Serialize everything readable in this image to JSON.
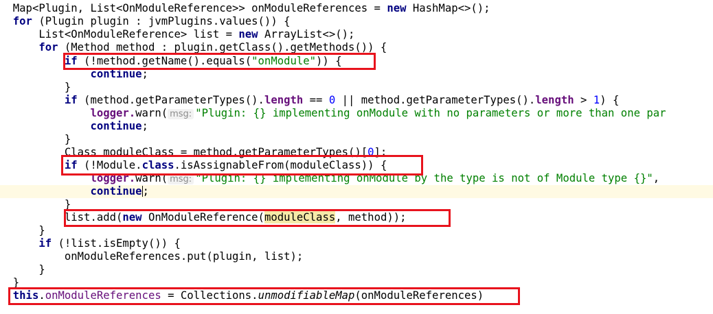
{
  "code": {
    "l1": {
      "a": "Map<Plugin, List<OnModuleReference>> onModuleReferences = ",
      "b": "new",
      "c": " HashMap<>();"
    },
    "l2": {
      "a": "for",
      "b": " (Plugin plugin : jvmPlugins.values()) {"
    },
    "l3": {
      "a": "List<OnModuleReference> list = ",
      "b": "new",
      "c": " ArrayList<>();"
    },
    "l4": {
      "a": "for",
      "b": " (Method method : plugin.getClass().getMethods()) {"
    },
    "l5": {
      "a": "if",
      "b": " (!method.getName().equals(",
      "c": "\"onModule\"",
      "d": ")) {"
    },
    "l6": {
      "a": "continue",
      "b": ";"
    },
    "l7": {
      "a": "}"
    },
    "l8": {
      "a": "if",
      "b": " (method.getParameterTypes().",
      "c": "length",
      "d": " == ",
      "e": "0",
      "f": " || method.getParameterTypes().",
      "g": "length",
      "h": " > ",
      "i": "1",
      "j": ") {"
    },
    "l9": {
      "a": "logger.",
      "b": "warn(",
      "hint": "msg:",
      "c": "\"Plugin: {} implementing onModule with no parameters or more than one par"
    },
    "l10": {
      "a": "continue",
      "b": ";"
    },
    "l11": {
      "a": "}"
    },
    "l12": {
      "a": "Class moduleClass = method.getParameterTypes()[",
      "b": "0",
      "c": "];"
    },
    "l13": {
      "a": "if",
      "b": " (!Module.",
      "c": "class",
      "d": ".isAssignableFrom(moduleClass)) {"
    },
    "l14": {
      "a": "logger.",
      "b": "warn(",
      "hint": "msg:",
      "c": "\"Plugin: {} implementing onModule by the type is not of Module type {}\"",
      "d": ","
    },
    "l15": {
      "a": "continue",
      "b": ";"
    },
    "l16": {
      "a": "}"
    },
    "l17": {
      "a": "list.add(",
      "b": "new",
      "c": " OnModuleReference(",
      "d": "moduleClass",
      "e": ", method));"
    },
    "l18": {
      "a": "}"
    },
    "l19": {
      "a": "if",
      "b": " (!list.isEmpty()) {"
    },
    "l20": {
      "a": "onModuleReferences.put(plugin, list);"
    },
    "l21": {
      "a": "}"
    },
    "l22": {
      "a": "}"
    },
    "l23": {
      "a": "this",
      "b": ".",
      "c": "onModuleReferences",
      "d": " = Collections.",
      "e": "unmodifiableMap",
      "f": "(onModuleReferences)"
    }
  },
  "colors": {
    "keyword": "#000080",
    "field": "#660e7a",
    "number": "#0000ff",
    "string": "#008000",
    "annotation_box": "#e8131d",
    "current_line": "#fffae3"
  }
}
